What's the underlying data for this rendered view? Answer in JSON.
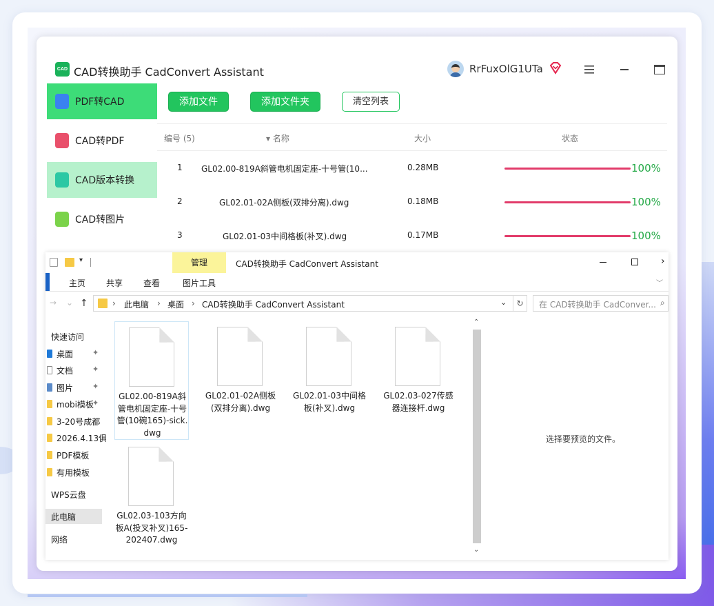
{
  "app": {
    "logo_text": "CAD",
    "title": "CAD转换助手 CadConvert Assistant",
    "user_name": "RrFuxOlG1UTa",
    "icons": {
      "avatar": "user-avatar",
      "vip": "vip-diamond-icon",
      "menu": "hamburger-menu-icon",
      "minimize": "minimize-icon",
      "maximize": "maximize-icon"
    },
    "accent": "#22c55e"
  },
  "sidebar": {
    "items": [
      {
        "label": "PDF转CAD",
        "icon": "pdf-to-cad-icon",
        "state": "active"
      },
      {
        "label": "CAD转PDF",
        "icon": "cad-to-pdf-icon",
        "state": "normal"
      },
      {
        "label": "CAD版本转换",
        "icon": "cad-version-icon",
        "state": "hover"
      },
      {
        "label": "CAD转图片",
        "icon": "cad-to-image-icon",
        "state": "normal"
      }
    ]
  },
  "toolbar": {
    "add_file": "添加文件",
    "add_folder": "添加文件夹",
    "clear_list": "清空列表"
  },
  "table": {
    "headers": {
      "number": "编号 (5)",
      "name": "▾ 名称",
      "size": "大小",
      "status": "状态"
    },
    "rows": [
      {
        "index": "1",
        "name": "GL02.00-819A斜管电机固定座-十号管(10...",
        "size": "0.28MB",
        "progress_text": "100%",
        "progress": 1.0
      },
      {
        "index": "2",
        "name": "GL02.01-02A侧板(双排分离).dwg",
        "size": "0.18MB",
        "progress_text": "100%",
        "progress": 1.0
      },
      {
        "index": "3",
        "name": "GL02.01-03中间格板(补叉).dwg",
        "size": "0.17MB",
        "progress_text": "100%",
        "progress": 1.0
      }
    ],
    "progress_color": "#e23b6a"
  },
  "explorer": {
    "quick_access": "▾",
    "manage_tab": "管理",
    "window_title": "CAD转换助手 CadConvert Assistant",
    "ribbon_tabs": [
      "主页",
      "共享",
      "查看",
      "图片工具"
    ],
    "address": {
      "crumbs": [
        "此电脑",
        "桌面",
        "CAD转换助手 CadConvert Assistant"
      ],
      "separator": "›"
    },
    "search_placeholder": "在 CAD转换助手 CadConver...",
    "nav_items": [
      {
        "label": "快速访问",
        "icon": "star-icon",
        "pinned": false
      },
      {
        "label": "桌面",
        "icon": "desktop-icon",
        "pinned": true
      },
      {
        "label": "文档",
        "icon": "document-icon",
        "pinned": true
      },
      {
        "label": "图片",
        "icon": "picture-icon",
        "pinned": true
      },
      {
        "label": "mobi模板",
        "icon": "folder-icon",
        "pinned": true
      },
      {
        "label": "3-20号成都",
        "icon": "folder-icon",
        "pinned": false
      },
      {
        "label": "2026.4.13俱",
        "icon": "folder-icon",
        "pinned": false
      },
      {
        "label": "PDF模板",
        "icon": "folder-icon",
        "pinned": false
      },
      {
        "label": "有用模板",
        "icon": "folder-icon",
        "pinned": false
      },
      {
        "label": "WPS云盘",
        "icon": "cloud-icon",
        "pinned": false
      },
      {
        "label": "此电脑",
        "icon": "computer-icon",
        "pinned": false
      },
      {
        "label": "网络",
        "icon": "network-icon",
        "pinned": false
      }
    ],
    "files": [
      {
        "name": "GL02.00-819A斜管电机固定座-十号管(10碗165)-sick.dwg"
      },
      {
        "name": "GL02.01-02A侧板(双排分离).dwg"
      },
      {
        "name": "GL02.01-03中间格板(补叉).dwg"
      },
      {
        "name": "GL02.03-027传感器连接杆.dwg"
      },
      {
        "name": "GL02.03-103方向板A(投叉补叉)165-202407.dwg"
      }
    ],
    "preview_text": "选择要预览的文件。"
  }
}
